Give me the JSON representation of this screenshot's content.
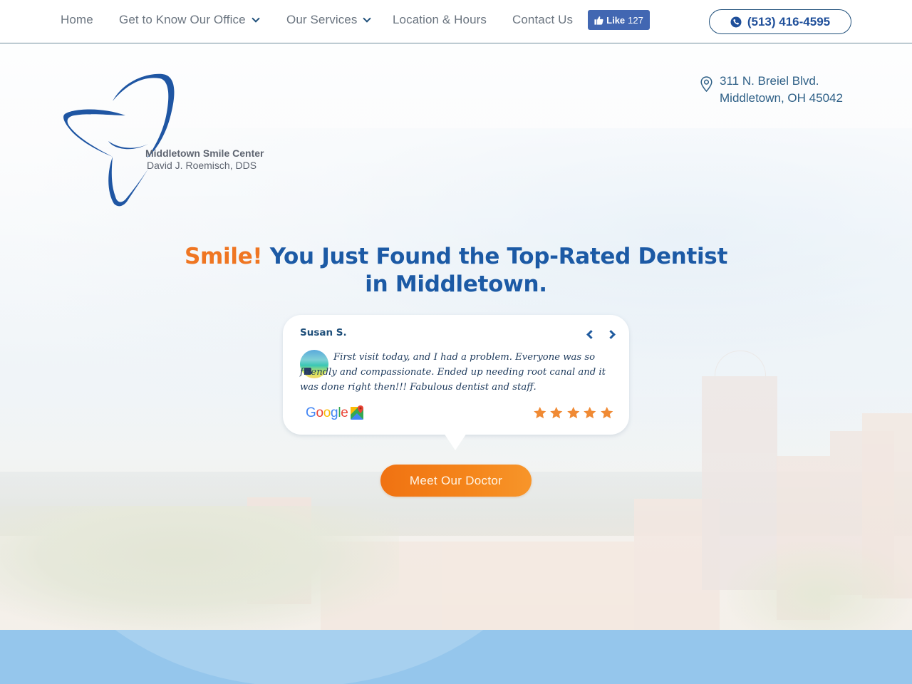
{
  "nav": {
    "items": [
      {
        "label": "Home",
        "has_dropdown": false
      },
      {
        "label": "Get to Know Our Office",
        "has_dropdown": true
      },
      {
        "label": "Our Services",
        "has_dropdown": true
      },
      {
        "label": "Location & Hours",
        "has_dropdown": false
      },
      {
        "label": "Contact Us",
        "has_dropdown": false
      }
    ],
    "facebook_like": {
      "label": "Like",
      "count": "127",
      "color": "#4267b2"
    },
    "phone": {
      "label": "(513) 416-4595",
      "icon": "phone-icon"
    }
  },
  "logo": {
    "title": "Middletown Smile Center",
    "subtitle": "David J. Roemisch, DDS",
    "icon": "tooth-logo-icon",
    "color": "#1f56a3"
  },
  "address": {
    "icon": "map-pin-icon",
    "line1": "311 N. Breiel Blvd.",
    "line2": "Middletown, OH 45042"
  },
  "hero": {
    "headline_accent": "Smile!",
    "headline_rest": " You Just Found the Top-Rated Dentist in Middletown.",
    "accent_color": "#ef7622",
    "primary_color": "#1c5aa5"
  },
  "review": {
    "reviewer": "Susan S.",
    "text": "First visit today, and I had a problem. Everyone was so friendly and compassionate. Ended up needing root canal and it was done right then!!! Fabulous dentist and staff.",
    "source": "Google",
    "source_icon": "google-maps-icon",
    "rating": 5,
    "rating_max": 5,
    "star_color": "#f08a34",
    "prev_label": "previous-review",
    "next_label": "next-review"
  },
  "cta": {
    "label": "Meet Our Doctor"
  }
}
